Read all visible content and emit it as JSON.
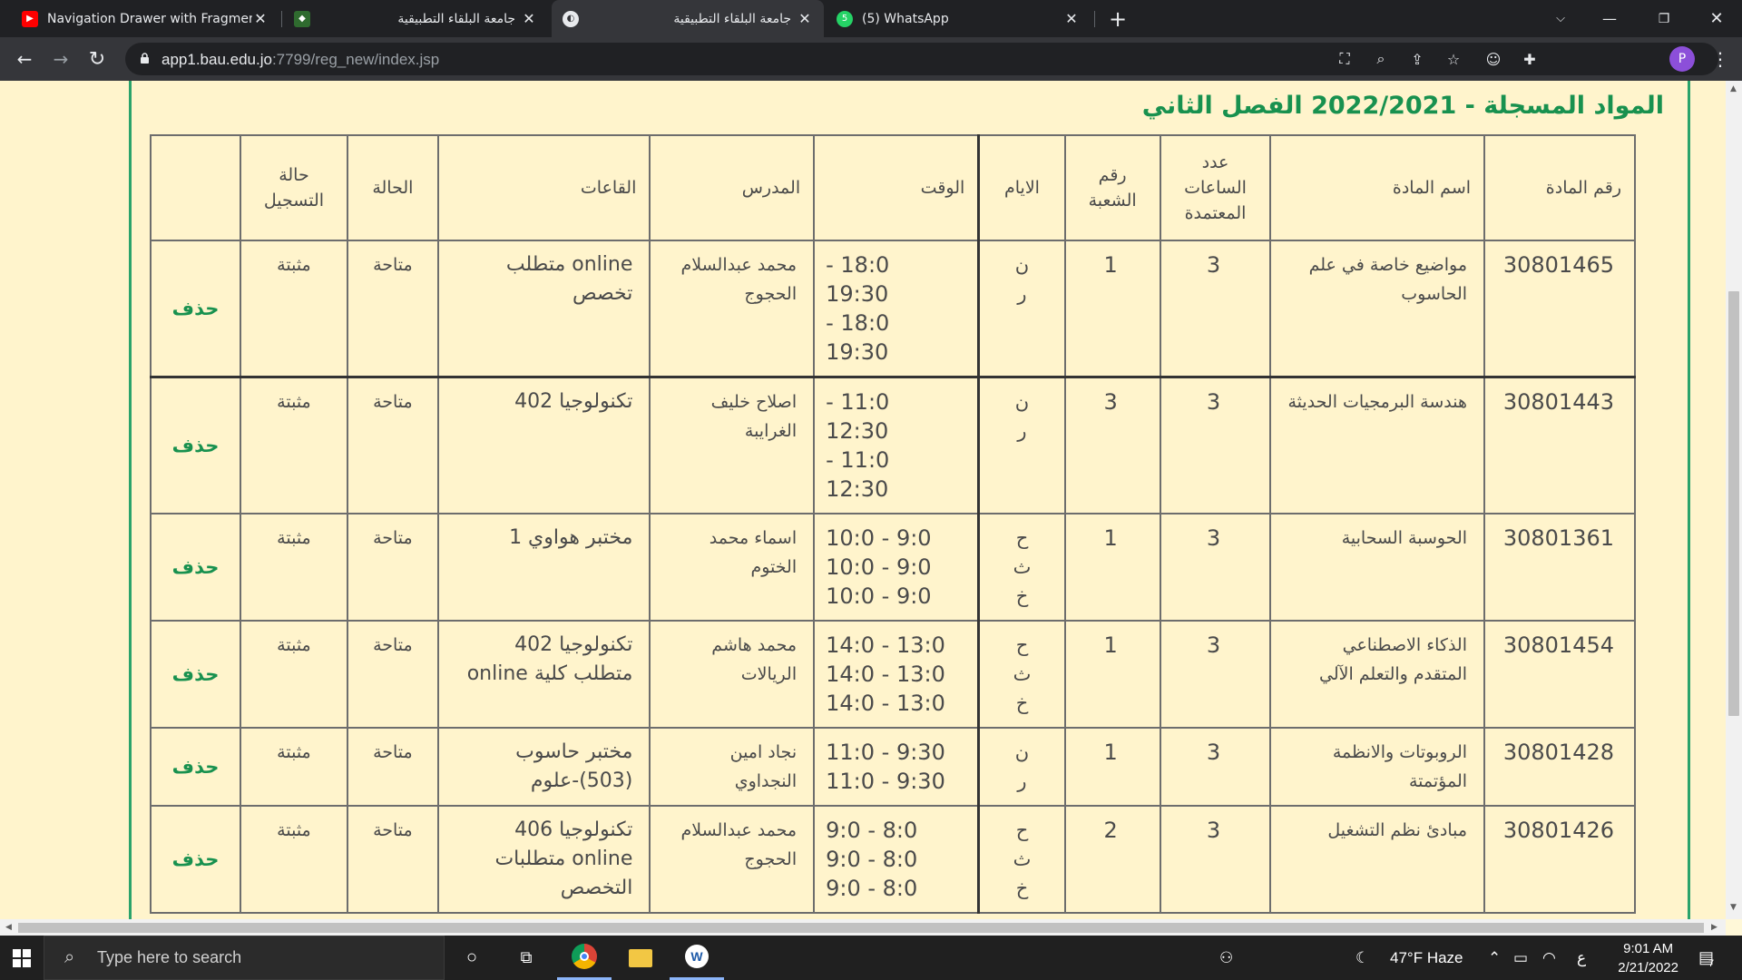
{
  "browser": {
    "tabs": [
      {
        "title": "Navigation Drawer with Fragmen",
        "active": false
      },
      {
        "title": "جامعة البلقاء التطبيقية",
        "active": false
      },
      {
        "title": "جامعة البلقاء التطبيقية",
        "active": true
      },
      {
        "title": "(5) WhatsApp",
        "active": false
      }
    ],
    "whatsapp_badge": "5",
    "url_host": "app1.bau.edu.jo",
    "url_path": ":7799/reg_new/index.jsp",
    "avatar_letter": "P"
  },
  "page": {
    "heading": "المواد المسجلة  -  2022/2021 الفصل الثاني",
    "accent_color": "#18914f",
    "columns": {
      "course_no": "رقم المادة",
      "course_name": "اسم المادة",
      "credit_hours": "عدد الساعات المعتمدة",
      "section": "رقم الشعبة",
      "days": "الايام",
      "time": "الوقت",
      "instructor": "المدرس",
      "rooms": "القاعات",
      "status": "الحالة",
      "reg_status": "حالة التسجيل",
      "action": ""
    },
    "rows": [
      {
        "course_no": "30801465",
        "course_name": "مواضيع خاصة في علم الحاسوب",
        "credit_hours": "3",
        "section": "1",
        "days": [
          "ن",
          "ر"
        ],
        "time": [
          "18:0 -",
          "19:30",
          "18:0 -",
          "19:30"
        ],
        "instructor": "محمد عبدالسلام الحجوج",
        "rooms": "online متطلب تخصص",
        "status": "متاحة",
        "reg_status": "مثبتة",
        "action": "حذف"
      },
      {
        "course_no": "30801443",
        "course_name": "هندسة البرمجيات الحديثة",
        "credit_hours": "3",
        "section": "3",
        "days": [
          "ن",
          "ر"
        ],
        "time": [
          "11:0 -",
          "12:30",
          "11:0 -",
          "12:30"
        ],
        "instructor": "اصلاح خليف الغرايبة",
        "rooms": "تكنولوجيا 402",
        "status": "متاحة",
        "reg_status": "مثبتة",
        "action": "حذف"
      },
      {
        "course_no": "30801361",
        "course_name": "الحوسبة السحابية",
        "credit_hours": "3",
        "section": "1",
        "days": [
          "ح",
          "ث",
          "خ"
        ],
        "time": [
          "9:0 - 10:0",
          "9:0 - 10:0",
          "9:0 - 10:0"
        ],
        "instructor": "اسماء محمد الختوم",
        "rooms": "مختبر هواوي 1",
        "status": "متاحة",
        "reg_status": "مثبتة",
        "action": "حذف"
      },
      {
        "course_no": "30801454",
        "course_name": "الذكاء الاصطناعي المتقدم والتعلم الآلي",
        "credit_hours": "3",
        "section": "1",
        "days": [
          "ح",
          "ث",
          "خ"
        ],
        "time": [
          "13:0 - 14:0",
          "13:0 - 14:0",
          "13:0 - 14:0"
        ],
        "instructor": "محمد هاشم الريالات",
        "rooms": "تكنولوجيا 402 متطلب كلية online",
        "status": "متاحة",
        "reg_status": "مثبتة",
        "action": "حذف"
      },
      {
        "course_no": "30801428",
        "course_name": "الروبوتات والانظمة المؤتمتة",
        "credit_hours": "3",
        "section": "1",
        "days": [
          "ن",
          "ر"
        ],
        "time": [
          "9:30 - 11:0",
          "9:30 - 11:0"
        ],
        "instructor": "نجاد امين النجداوي",
        "rooms": "مختبر حاسوب (503)-علوم",
        "status": "متاحة",
        "reg_status": "مثبتة",
        "action": "حذف"
      },
      {
        "course_no": "30801426",
        "course_name": "مبادئ نظم التشغيل",
        "credit_hours": "3",
        "section": "2",
        "days": [
          "ح",
          "ث",
          "خ"
        ],
        "time": [
          "8:0 - 9:0",
          "8:0 - 9:0",
          "8:0 - 9:0"
        ],
        "instructor": "محمد عبدالسلام الحجوج",
        "rooms": "تكنولوجيا 406 online متطلبات التخصص",
        "status": "متاحة",
        "reg_status": "مثبتة",
        "action": "حذف"
      }
    ]
  },
  "taskbar": {
    "search_placeholder": "Type here to search",
    "weather": "47°F  Haze",
    "lang": "ع",
    "time": "9:01 AM",
    "date": "2/21/2022",
    "notif_count": "7"
  }
}
